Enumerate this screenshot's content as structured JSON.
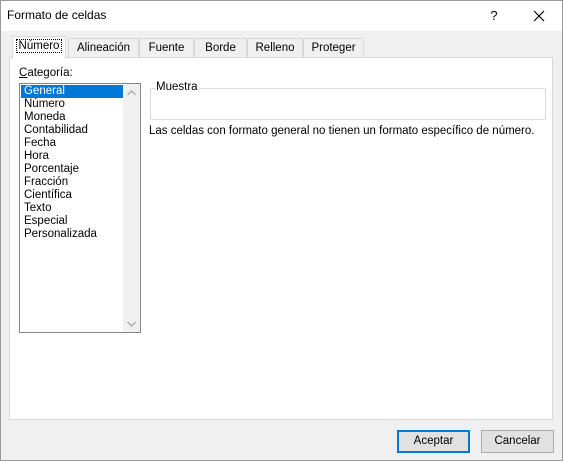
{
  "window": {
    "title": "Formato de celdas",
    "help_glyph": "?",
    "close_glyph": "✕"
  },
  "tabs": [
    {
      "label": "Número"
    },
    {
      "label": "Alineación"
    },
    {
      "label": "Fuente"
    },
    {
      "label": "Borde"
    },
    {
      "label": "Relleno"
    },
    {
      "label": "Proteger"
    }
  ],
  "category": {
    "label_underlined": "C",
    "label_rest": "ategoría:",
    "items": [
      "General",
      "Número",
      "Moneda",
      "Contabilidad",
      "Fecha",
      "Hora",
      "Porcentaje",
      "Fracción",
      "Científica",
      "Texto",
      "Especial",
      "Personalizada"
    ],
    "selected": "General"
  },
  "sample": {
    "label": "Muestra"
  },
  "description": "Las celdas con formato general no tienen un formato específico de número.",
  "buttons": {
    "accept": "Aceptar",
    "cancel": "Cancelar"
  },
  "colors": {
    "selection": "#0078d7",
    "default_button_border": "#0078d7"
  }
}
